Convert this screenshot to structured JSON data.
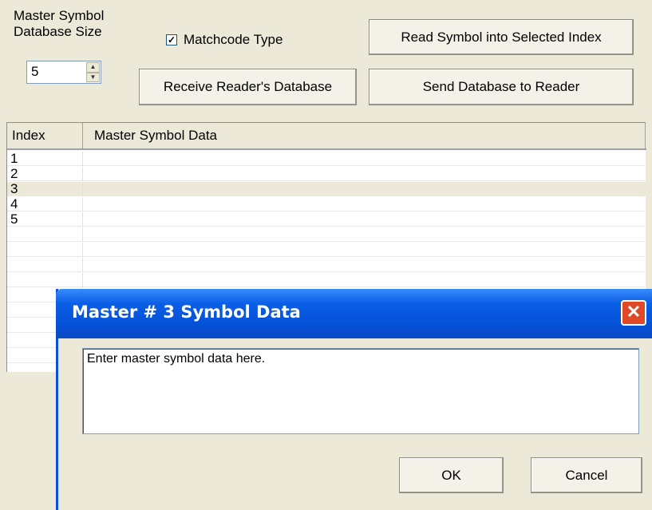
{
  "controls": {
    "db_size_label_line1": "Master Symbol",
    "db_size_label_line2": "Database Size",
    "db_size_value": "5",
    "matchcode_checked": true,
    "matchcode_label": "Matchcode Type",
    "read_button": "Read Symbol into Selected Index",
    "receive_button": "Receive Reader's Database",
    "send_button": "Send Database to Reader"
  },
  "table": {
    "columns": [
      "Index",
      "Master Symbol Data"
    ],
    "rows": [
      {
        "index": "1",
        "data": ""
      },
      {
        "index": "2",
        "data": ""
      },
      {
        "index": "3",
        "data": ""
      },
      {
        "index": "4",
        "data": ""
      },
      {
        "index": "5",
        "data": ""
      }
    ],
    "selected_index": "3"
  },
  "dialog": {
    "title": "Master # 3 Symbol Data",
    "text_value": "Enter master symbol data here.",
    "ok_label": "OK",
    "cancel_label": "Cancel",
    "close_glyph": "✕"
  },
  "colors": {
    "title_bar": "#0552D8",
    "close_button": "#E0482A",
    "window_bg": "#ECE9D8"
  }
}
